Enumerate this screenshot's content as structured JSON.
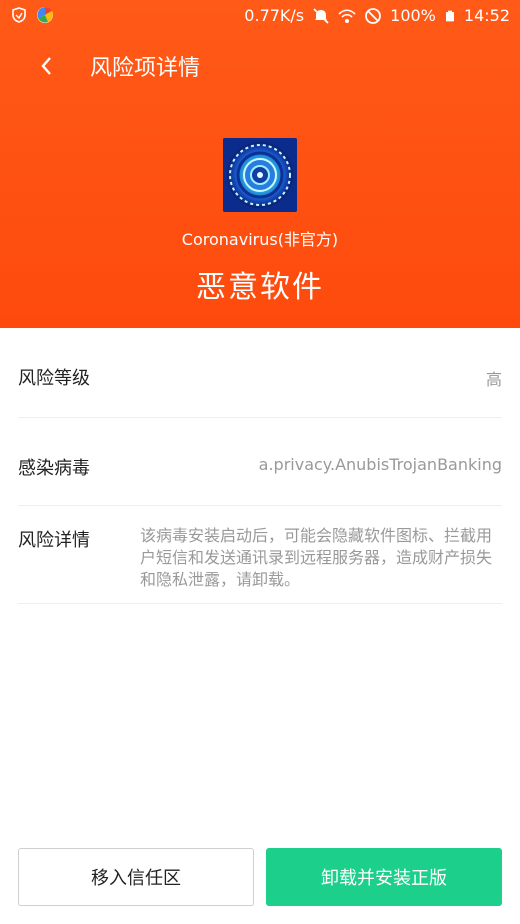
{
  "statusbar": {
    "speed": "0.77K/s",
    "battery": "100%",
    "time": "14:52",
    "icons": [
      "shield-icon",
      "app-launcher-icon",
      "mute-icon",
      "wifi-icon",
      "dnd-icon",
      "battery-icon"
    ]
  },
  "appbar": {
    "title": "风险项详情",
    "back_icon": "chevron-left-icon"
  },
  "app": {
    "name": "Coronavirus(非官方)",
    "risk_type": "恶意软件"
  },
  "details": [
    {
      "label": "风险等级",
      "value": "高"
    },
    {
      "label": "感染病毒",
      "value": "a.privacy.AnubisTrojanBanking"
    },
    {
      "label": "风险详情",
      "value": "该病毒安装启动后，可能会隐藏软件图标、拦截用户短信和发送通讯录到远程服务器，造成财产损失和隐私泄露，请卸载。"
    }
  ],
  "actions": {
    "trust_label": "移入信任区",
    "uninstall_label": "卸载并安装正版"
  },
  "colors": {
    "header": "#fe4a0d",
    "primary_button": "#1ccf8a"
  }
}
